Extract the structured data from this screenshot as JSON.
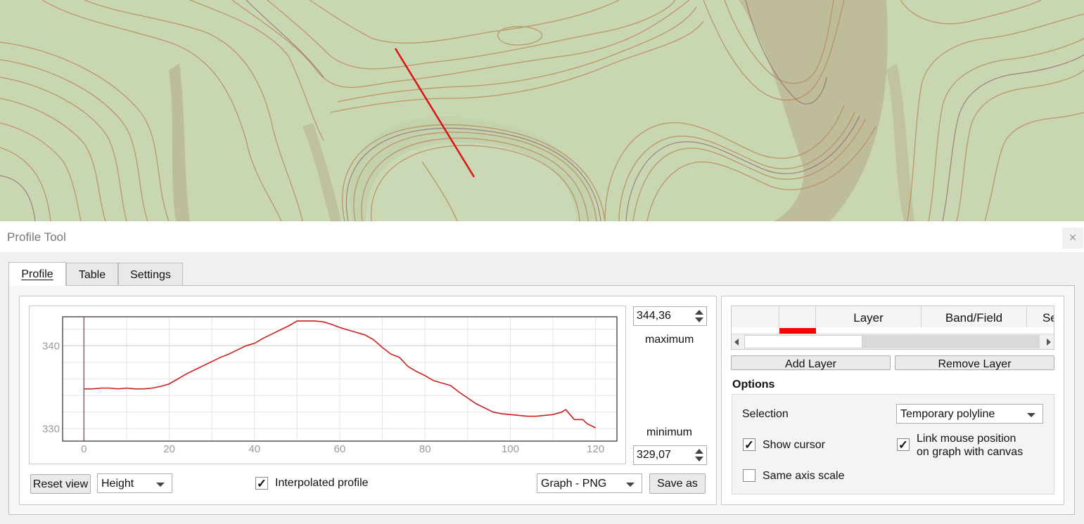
{
  "window": {
    "title": "Profile Tool",
    "close_icon": "close-icon"
  },
  "tabs": [
    {
      "label": "Profile"
    },
    {
      "label": "Table"
    },
    {
      "label": "Settings"
    }
  ],
  "plot": {
    "max_value": "344,36",
    "max_label": "maximum",
    "min_value": "329,07",
    "min_label": "minimum",
    "line_color": "#cc1f1f",
    "x_ticks": [
      "0",
      "20",
      "40",
      "60",
      "80",
      "100",
      "120"
    ],
    "y_ticks": [
      "330",
      "340"
    ]
  },
  "controls": {
    "reset_view": "Reset view",
    "mode_combo": "Height",
    "interpolated_label": "Interpolated profile",
    "interpolated_checked": true,
    "export_combo": "Graph - PNG",
    "save_as": "Save as"
  },
  "layers": {
    "headers": [
      "",
      "",
      "Layer",
      "Band/Field",
      "Se"
    ],
    "add_layer": "Add Layer",
    "remove_layer": "Remove Layer",
    "swatch_color": "#ff0000"
  },
  "options": {
    "title": "Options",
    "selection_label": "Selection",
    "selection_value": "Temporary polyline",
    "show_cursor": "Show cursor",
    "show_cursor_checked": true,
    "link_mouse_line1": "Link mouse position",
    "link_mouse_line2": "on graph with canvas",
    "link_mouse_checked": true,
    "same_axis": "Same axis scale",
    "same_axis_checked": false
  },
  "chart_data": {
    "type": "line",
    "title": "",
    "xlabel": "",
    "ylabel": "",
    "xlim": [
      -5,
      125
    ],
    "ylim": [
      328.5,
      343.5
    ],
    "grid": true,
    "series": [
      {
        "x": [
          0,
          2,
          4,
          6,
          8,
          10,
          12,
          14,
          16,
          18,
          20,
          22,
          24,
          26,
          28,
          30,
          32,
          34,
          36,
          38,
          40,
          42,
          44,
          46,
          48,
          50,
          52,
          54,
          56,
          58,
          60,
          62,
          64,
          66,
          68,
          70,
          72,
          74,
          76,
          78,
          80,
          82,
          84,
          86,
          88,
          90,
          92,
          94,
          96,
          98,
          100,
          102,
          104,
          106,
          108,
          110,
          112,
          113,
          115,
          117,
          118,
          120
        ],
        "y": [
          334.8,
          334.8,
          334.9,
          334.9,
          334.8,
          334.9,
          334.8,
          334.8,
          334.9,
          335.1,
          335.4,
          336.0,
          336.6,
          337.1,
          337.6,
          338.1,
          338.6,
          339.0,
          339.5,
          340.0,
          340.3,
          340.9,
          341.4,
          341.9,
          342.4,
          343.0,
          343.0,
          343.0,
          342.9,
          342.6,
          342.2,
          341.9,
          341.6,
          341.3,
          340.7,
          339.8,
          339.0,
          338.6,
          337.5,
          336.9,
          336.4,
          335.8,
          335.5,
          335.2,
          334.4,
          333.7,
          333.0,
          332.5,
          332.0,
          331.8,
          331.7,
          331.6,
          331.5,
          331.5,
          331.6,
          331.7,
          332.0,
          332.3,
          331.1,
          331.1,
          330.6,
          330.1
        ]
      }
    ]
  }
}
